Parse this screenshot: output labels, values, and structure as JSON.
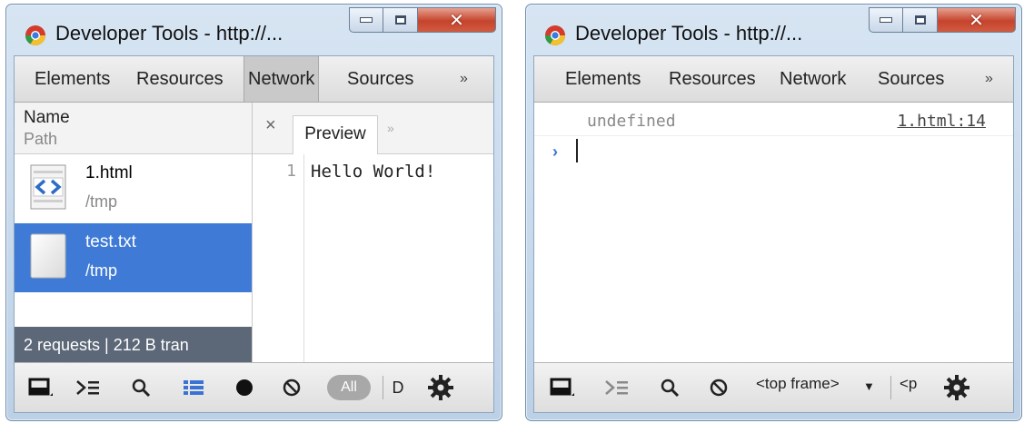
{
  "colors": {
    "selected_row": "#3f7bd6",
    "status_bar": "#5c6778",
    "prompt": "#3a74d3"
  },
  "left_window": {
    "title": "Developer Tools - http://...",
    "tabs": [
      "Elements",
      "Resources",
      "Network",
      "Sources"
    ],
    "selected_tab": "Network",
    "more_tabs": "»",
    "network": {
      "column_name": "Name",
      "column_path": "Path",
      "rows": [
        {
          "name": "1.html",
          "path": "/tmp",
          "icon": "html-file-icon"
        },
        {
          "name": "test.txt",
          "path": "/tmp",
          "icon": "text-file-icon",
          "selected": true
        }
      ],
      "status": "2 requests  |  212 B tran"
    },
    "preview": {
      "close": "×",
      "tab": "Preview",
      "more": "»",
      "line_number": "1",
      "code": "Hello World!"
    },
    "toolbar": {
      "all_label": "All",
      "clipped_label": "D"
    }
  },
  "right_window": {
    "title": "Developer Tools - http://...",
    "tabs": [
      "Elements",
      "Resources",
      "Network",
      "Sources"
    ],
    "more_tabs": "»",
    "console": {
      "value": "undefined",
      "link": "1.html:14",
      "prompt": "›"
    },
    "toolbar": {
      "frame_select": "<top frame>",
      "frame_arrow": "▼",
      "clipped_label": "<p"
    }
  }
}
